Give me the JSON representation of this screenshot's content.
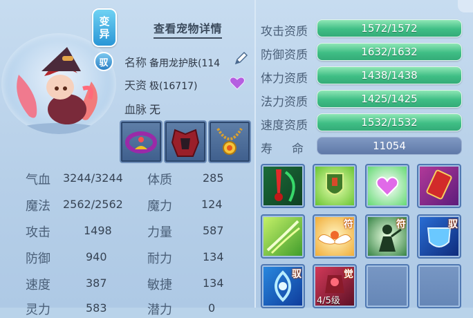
{
  "header": {
    "detail_link": "查看宠物详情"
  },
  "badges": {
    "mutant_line1": "变",
    "mutant_line2": "异",
    "tame": "驭"
  },
  "info": {
    "name_label": "名称",
    "name_value": "备用龙护肤(114",
    "aptitude_label": "天资",
    "aptitude_value": "极(16717)",
    "bloodline_label": "血脉",
    "bloodline_value": "无"
  },
  "equipment": [
    {
      "icon": "demon-collar-icon"
    },
    {
      "icon": "red-armor-icon"
    },
    {
      "icon": "gold-necklace-icon"
    }
  ],
  "stats": [
    {
      "label": "气血",
      "value": "3244/3244",
      "label2": "体质",
      "value2": "285"
    },
    {
      "label": "魔法",
      "value": "2562/2562",
      "label2": "魔力",
      "value2": "124"
    },
    {
      "label": "攻击",
      "value": "1498",
      "label2": "力量",
      "value2": "587"
    },
    {
      "label": "防御",
      "value": "940",
      "label2": "耐力",
      "value2": "134"
    },
    {
      "label": "速度",
      "value": "387",
      "label2": "敏捷",
      "value2": "134"
    },
    {
      "label": "灵力",
      "value": "583",
      "label2": "潜力",
      "value2": "0"
    }
  ],
  "aptitudes": [
    {
      "label": "攻击资质",
      "value": "1572/1572"
    },
    {
      "label": "防御资质",
      "value": "1632/1632"
    },
    {
      "label": "体力资质",
      "value": "1438/1438"
    },
    {
      "label": "法力资质",
      "value": "1425/1425"
    },
    {
      "label": "速度资质",
      "value": "1532/1532"
    }
  ],
  "lifespan": {
    "label1": "寿",
    "label2": "命",
    "value": "11054"
  },
  "skills": [
    {
      "icon": "blood-drain-skill-icon",
      "tag": ""
    },
    {
      "icon": "shield-guard-skill-icon",
      "tag": ""
    },
    {
      "icon": "heart-heal-skill-icon",
      "tag": ""
    },
    {
      "icon": "red-card-skill-icon",
      "tag": ""
    },
    {
      "icon": "wind-slash-skill-icon",
      "tag": ""
    },
    {
      "icon": "golden-wings-skill-icon",
      "tag": "符"
    },
    {
      "icon": "shadow-warrior-skill-icon",
      "tag": "符"
    },
    {
      "icon": "blue-shield-skill-icon",
      "tag": "驭"
    },
    {
      "icon": "blue-whirl-skill-icon",
      "tag": "驭"
    },
    {
      "icon": "awaken-skill-icon",
      "tag": "觉",
      "level": "4/5级"
    },
    {
      "icon": "empty-slot",
      "tag": ""
    },
    {
      "icon": "empty-slot",
      "tag": ""
    }
  ],
  "colors": {
    "aptitude_bar": "#3fbe85",
    "lifespan_bar": "#6f88b6",
    "accent_text": "#4a5f78"
  }
}
